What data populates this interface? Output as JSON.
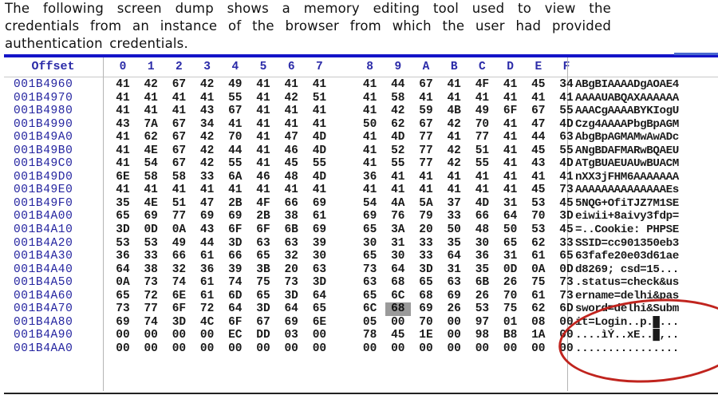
{
  "caption": "The following screen dump shows  a memory editing tool used to view the credentials from an  instance of the browser from which the user had provided authentication credentials.",
  "hex_viewer": {
    "header": {
      "offset_label": "Offset",
      "columns": [
        "0",
        "1",
        "2",
        "3",
        "4",
        "5",
        "6",
        "7",
        "8",
        "9",
        "A",
        "B",
        "C",
        "D",
        "E",
        "F"
      ]
    },
    "selected_cell": {
      "row_offset": "001B4A70",
      "column": "9",
      "value": "68"
    },
    "annotation": {
      "type": "red-ellipse",
      "color": "#c0241e",
      "highlights": "status=check&username=delhi&password=delhi&Submit=Login"
    },
    "colors": {
      "offset_text": "#2424a0",
      "header_text": "#2b2ba8",
      "accent_bar": "#1414c8"
    },
    "rows": [
      {
        "offset": "001B4960",
        "bytes": [
          "41",
          "42",
          "67",
          "42",
          "49",
          "41",
          "41",
          "41",
          "41",
          "44",
          "67",
          "41",
          "4F",
          "41",
          "45",
          "34"
        ],
        "ascii": "ABgBIAAAADgAOAE4"
      },
      {
        "offset": "001B4970",
        "bytes": [
          "41",
          "41",
          "41",
          "41",
          "55",
          "41",
          "42",
          "51",
          "41",
          "58",
          "41",
          "41",
          "41",
          "41",
          "41",
          "41"
        ],
        "ascii": "AAAAUABQAXAAAAAA"
      },
      {
        "offset": "001B4980",
        "bytes": [
          "41",
          "41",
          "41",
          "43",
          "67",
          "41",
          "41",
          "41",
          "41",
          "42",
          "59",
          "4B",
          "49",
          "6F",
          "67",
          "55"
        ],
        "ascii": "AAACgAAAABYKIogU"
      },
      {
        "offset": "001B4990",
        "bytes": [
          "43",
          "7A",
          "67",
          "34",
          "41",
          "41",
          "41",
          "41",
          "50",
          "62",
          "67",
          "42",
          "70",
          "41",
          "47",
          "4D"
        ],
        "ascii": "Czg4AAAAPbgBpAGM"
      },
      {
        "offset": "001B49A0",
        "bytes": [
          "41",
          "62",
          "67",
          "42",
          "70",
          "41",
          "47",
          "4D",
          "41",
          "4D",
          "77",
          "41",
          "77",
          "41",
          "44",
          "63"
        ],
        "ascii": "AbgBpAGMAMwAwADc"
      },
      {
        "offset": "001B49B0",
        "bytes": [
          "41",
          "4E",
          "67",
          "42",
          "44",
          "41",
          "46",
          "4D",
          "41",
          "52",
          "77",
          "42",
          "51",
          "41",
          "45",
          "55"
        ],
        "ascii": "ANgBDAFMARwBQAEU"
      },
      {
        "offset": "001B49C0",
        "bytes": [
          "41",
          "54",
          "67",
          "42",
          "55",
          "41",
          "45",
          "55",
          "41",
          "55",
          "77",
          "42",
          "55",
          "41",
          "43",
          "4D"
        ],
        "ascii": "ATgBUAEUAUwBUACM"
      },
      {
        "offset": "001B49D0",
        "bytes": [
          "6E",
          "58",
          "58",
          "33",
          "6A",
          "46",
          "48",
          "4D",
          "36",
          "41",
          "41",
          "41",
          "41",
          "41",
          "41",
          "41"
        ],
        "ascii": "nXX3jFHM6AAAAAAA"
      },
      {
        "offset": "001B49E0",
        "bytes": [
          "41",
          "41",
          "41",
          "41",
          "41",
          "41",
          "41",
          "41",
          "41",
          "41",
          "41",
          "41",
          "41",
          "41",
          "45",
          "73"
        ],
        "ascii": "AAAAAAAAAAAAAAEs"
      },
      {
        "offset": "001B49F0",
        "bytes": [
          "35",
          "4E",
          "51",
          "47",
          "2B",
          "4F",
          "66",
          "69",
          "54",
          "4A",
          "5A",
          "37",
          "4D",
          "31",
          "53",
          "45"
        ],
        "ascii": "5NQG+OfiTJZ7M1SE"
      },
      {
        "offset": "001B4A00",
        "bytes": [
          "65",
          "69",
          "77",
          "69",
          "69",
          "2B",
          "38",
          "61",
          "69",
          "76",
          "79",
          "33",
          "66",
          "64",
          "70",
          "3D"
        ],
        "ascii": "eiwii+8aivy3fdp="
      },
      {
        "offset": "001B4A10",
        "bytes": [
          "3D",
          "0D",
          "0A",
          "43",
          "6F",
          "6F",
          "6B",
          "69",
          "65",
          "3A",
          "20",
          "50",
          "48",
          "50",
          "53",
          "45"
        ],
        "ascii": "=..Cookie: PHPSE"
      },
      {
        "offset": "001B4A20",
        "bytes": [
          "53",
          "53",
          "49",
          "44",
          "3D",
          "63",
          "63",
          "39",
          "30",
          "31",
          "33",
          "35",
          "30",
          "65",
          "62",
          "33"
        ],
        "ascii": "SSID=cc901350eb3"
      },
      {
        "offset": "001B4A30",
        "bytes": [
          "36",
          "33",
          "66",
          "61",
          "66",
          "65",
          "32",
          "30",
          "65",
          "30",
          "33",
          "64",
          "36",
          "31",
          "61",
          "65"
        ],
        "ascii": "63fafe20e03d61ae"
      },
      {
        "offset": "001B4A40",
        "bytes": [
          "64",
          "38",
          "32",
          "36",
          "39",
          "3B",
          "20",
          "63",
          "73",
          "64",
          "3D",
          "31",
          "35",
          "0D",
          "0A",
          "0D"
        ],
        "ascii": "d8269; csd=15..."
      },
      {
        "offset": "001B4A50",
        "bytes": [
          "0A",
          "73",
          "74",
          "61",
          "74",
          "75",
          "73",
          "3D",
          "63",
          "68",
          "65",
          "63",
          "6B",
          "26",
          "75",
          "73"
        ],
        "ascii": ".status=check&us"
      },
      {
        "offset": "001B4A60",
        "bytes": [
          "65",
          "72",
          "6E",
          "61",
          "6D",
          "65",
          "3D",
          "64",
          "65",
          "6C",
          "68",
          "69",
          "26",
          "70",
          "61",
          "73"
        ],
        "ascii": "ername=delhi&pas"
      },
      {
        "offset": "001B4A70",
        "bytes": [
          "73",
          "77",
          "6F",
          "72",
          "64",
          "3D",
          "64",
          "65",
          "6C",
          "68",
          "69",
          "26",
          "53",
          "75",
          "62",
          "6D"
        ],
        "ascii": "sword=delhi&Subm"
      },
      {
        "offset": "001B4A80",
        "bytes": [
          "69",
          "74",
          "3D",
          "4C",
          "6F",
          "67",
          "69",
          "6E",
          "05",
          "00",
          "70",
          "00",
          "97",
          "01",
          "08",
          "00"
        ],
        "ascii": "it=Login..p.█..."
      },
      {
        "offset": "001B4A90",
        "bytes": [
          "00",
          "00",
          "00",
          "00",
          "EC",
          "DD",
          "03",
          "00",
          "78",
          "45",
          "1E",
          "00",
          "98",
          "B8",
          "1A",
          "00"
        ],
        "ascii": "....ìÝ..xE..█,.."
      },
      {
        "offset": "001B4AA0",
        "bytes": [
          "00",
          "00",
          "00",
          "00",
          "00",
          "00",
          "00",
          "00",
          "00",
          "00",
          "00",
          "00",
          "00",
          "00",
          "00",
          "00"
        ],
        "ascii": "................"
      }
    ]
  }
}
